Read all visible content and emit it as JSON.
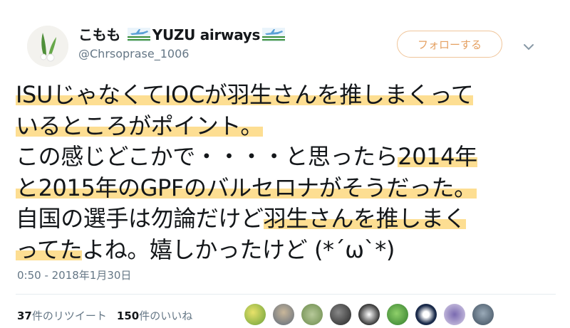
{
  "user": {
    "display_name": "こもも",
    "display_name_suffix": "YUZU airways",
    "handle": "@Chrsoprase_1006",
    "follow_label": "フォローする"
  },
  "tweet": {
    "lines": [
      {
        "pre": "",
        "hl": "ISUじゃなくてIOCが羽生さんを推しまくって",
        "post": ""
      },
      {
        "pre": "",
        "hl": "いるところがポイント。",
        "post": ""
      },
      {
        "pre": "この感じどこかで・・・・と思ったら",
        "hl": "2014年",
        "post": ""
      },
      {
        "pre": "",
        "hl": "と2015年のGPFのバルセロナがそうだった。",
        "post": ""
      },
      {
        "pre": "自国の選手は勿論だけど",
        "hl": "羽生さんを推しまく",
        "post": ""
      },
      {
        "pre": "",
        "hl": "ってた",
        "post": "よね。嬉しかったけど (*´ω`*)"
      }
    ],
    "timestamp": "0:50 - 2018年1月30日"
  },
  "stats": {
    "retweets_count": "37",
    "retweets_label": "件のリツイート",
    "likes_count": "150",
    "likes_label": "件のいいね"
  },
  "colors": {
    "highlight": "#fcd36e",
    "follow_orange": "#e5a061",
    "muted_text": "#657786"
  },
  "icons": [
    "avatar-leaf",
    "airplane-flag-icon",
    "chevron-down-icon"
  ]
}
